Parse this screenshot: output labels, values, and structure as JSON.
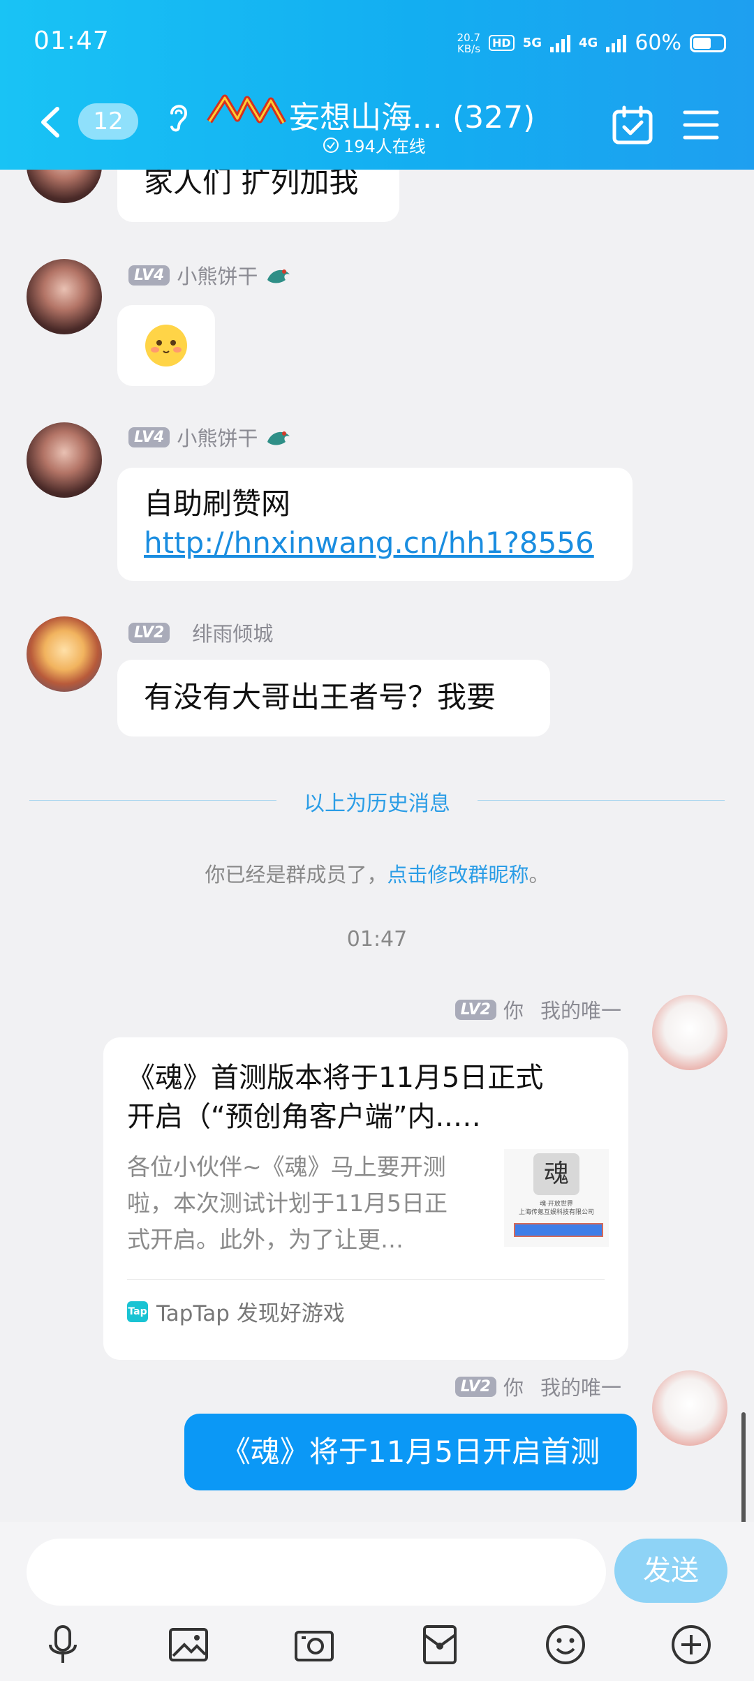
{
  "status": {
    "time": "01:47",
    "netspeed_value": "20.7",
    "netspeed_unit": "KB/s",
    "hd_label": "HD",
    "net_1": "5G",
    "net_2": "4G",
    "battery": "60%",
    "battery_level": 0.6
  },
  "header": {
    "unread": "12",
    "group_name": "妄想山海…",
    "member_count": "(327)",
    "online": "194人在线"
  },
  "messages": [
    {
      "text": "家人们 扩列加我"
    },
    {
      "level": "LV4",
      "name": "小熊饼干",
      "emoji": "shy-face"
    },
    {
      "level": "LV4",
      "name": "小熊饼干",
      "line1": "自助刷赞网",
      "link": "http://hnxinwang.cn/hh1?8556"
    },
    {
      "level": "LV2",
      "name": "绯雨倾城",
      "text": "有没有大哥出王者号？我要"
    }
  ],
  "divider": "以上为历史消息",
  "system": {
    "prefix": "你已经是群成员了，",
    "link": "点击修改群昵称",
    "suffix": "。"
  },
  "timestamp": "01:47",
  "my_messages": [
    {
      "level": "LV2",
      "you": "你",
      "name": "我的唯一",
      "card": {
        "title_line1": "《魂》首测版本将于11月5日正式",
        "title_line2": "开启（“预创角客户端”内..…",
        "desc_line1": "各位小伙伴~《魂》马上要开测",
        "desc_line2": "啦，本次测试计划于11月5日正",
        "desc_line3": "式开启。此外，为了让更…",
        "thumb_char": "魂",
        "thumb_line1": "魂·开放世界",
        "thumb_line2": "上海传氪互娱科技有限公司",
        "source": "TapTap 发现好游戏",
        "source_logo": "Tap"
      }
    },
    {
      "level": "LV2",
      "you": "你",
      "name": "我的唯一",
      "text": "《魂》将于11月5日开启首测"
    }
  ],
  "input": {
    "placeholder": "",
    "send": "发送"
  },
  "toolbar": [
    "mic-icon",
    "image-icon",
    "camera-icon",
    "red-packet-icon",
    "emoji-icon",
    "plus-icon"
  ],
  "colors": {
    "header": "#13aef1",
    "accent": "#0b98f6",
    "link": "#1a8de0",
    "send_disabled": "#8ed3f6"
  }
}
